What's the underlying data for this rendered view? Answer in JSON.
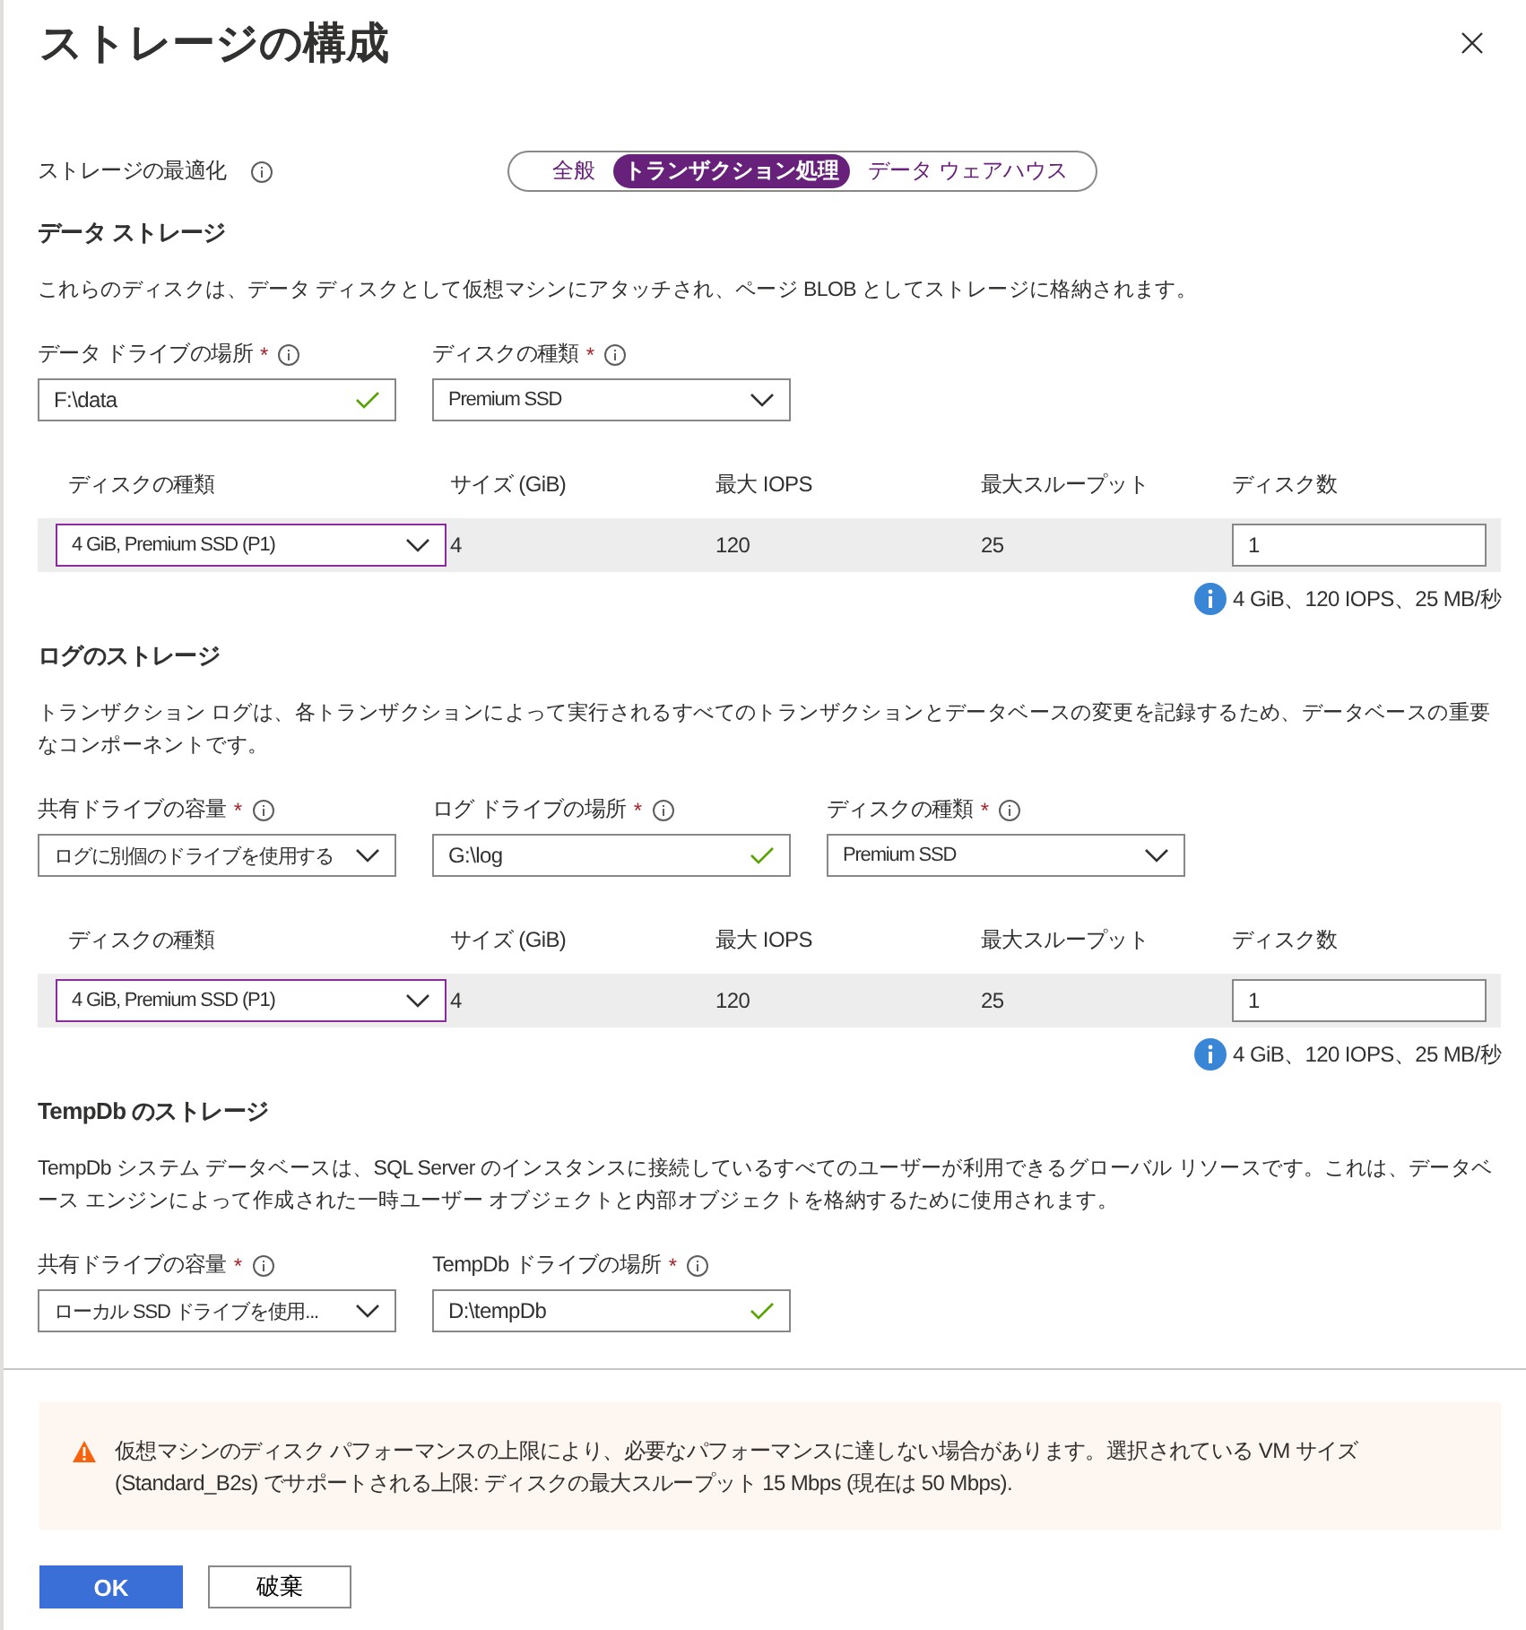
{
  "panel": {
    "title": "ストレージの構成"
  },
  "optimization": {
    "label": "ストレージの最適化",
    "options": [
      {
        "label": "全般",
        "selected": false
      },
      {
        "label": "トランザクション処理",
        "selected": true
      },
      {
        "label": "データ ウェアハウス",
        "selected": false
      }
    ]
  },
  "sections": [
    {
      "heading": "データ ストレージ",
      "description": "これらのディスクは、データ ディスクとして仮想マシンにアタッチされ、ページ BLOB としてストレージに格納されます。",
      "fields": [
        {
          "kind": "text",
          "label": "データ ドライブの場所",
          "required_mark": "*",
          "value": "F:\\data",
          "valid": true
        },
        {
          "kind": "dropdown",
          "label": "ディスクの種類",
          "required_mark": "*",
          "value": "Premium SSD"
        }
      ],
      "disk_table": {
        "columns": [
          "ディスクの種類",
          "サイズ (GiB)",
          "最大 IOPS",
          "最大スループット",
          "ディスク数"
        ],
        "rows": [
          {
            "disk_type": "4 GiB, Premium SSD (P1)",
            "size": "4",
            "max_iops": "120",
            "max_throughput": "25",
            "disk_count": "1"
          }
        ]
      },
      "summary": "4 GiB、120 IOPS、25 MB/秒"
    },
    {
      "heading": "ログのストレージ",
      "description": "トランザクション ログは、各トランザクションによって実行されるすべてのトランザクションとデータベースの変更を記録するため、データベースの重要なコンポーネントです。",
      "fields": [
        {
          "kind": "dropdown",
          "label": "共有ドライブの容量",
          "required_mark": "*",
          "value": "ログに別個のドライブを使用する"
        },
        {
          "kind": "text",
          "label": "ログ ドライブの場所",
          "required_mark": "*",
          "value": "G:\\log",
          "valid": true
        },
        {
          "kind": "dropdown",
          "label": "ディスクの種類",
          "required_mark": "*",
          "value": "Premium SSD"
        }
      ],
      "disk_table": {
        "columns": [
          "ディスクの種類",
          "サイズ (GiB)",
          "最大 IOPS",
          "最大スループット",
          "ディスク数"
        ],
        "rows": [
          {
            "disk_type": "4 GiB, Premium SSD (P1)",
            "size": "4",
            "max_iops": "120",
            "max_throughput": "25",
            "disk_count": "1"
          }
        ]
      },
      "summary": "4 GiB、120 IOPS、25 MB/秒"
    },
    {
      "heading": "TempDb のストレージ",
      "description": "TempDb システム データベースは、SQL Server のインスタンスに接続しているすべてのユーザーが利用できるグローバル リソースです。これは、データベース エンジンによって作成された一時ユーザー オブジェクトと内部オブジェクトを格納するために使用されます。",
      "fields": [
        {
          "kind": "dropdown",
          "label": "共有ドライブの容量",
          "required_mark": "*",
          "value": "ローカル SSD ドライブを使用..."
        },
        {
          "kind": "text",
          "label": "TempDb ドライブの場所",
          "required_mark": "*",
          "value": "D:\\tempDb",
          "valid": true
        }
      ]
    }
  ],
  "warning": {
    "text": "仮想マシンのディスク パフォーマンスの上限により、必要なパフォーマンスに達しない場合があります。選択されている VM サイズ (Standard_B2s) でサポートされる上限: ディスクの最大スループット 15 Mbps (現在は 50 Mbps)."
  },
  "buttons": [
    {
      "kind": "primary",
      "label": "OK"
    },
    {
      "kind": "secondary",
      "label": "破棄"
    }
  ]
}
